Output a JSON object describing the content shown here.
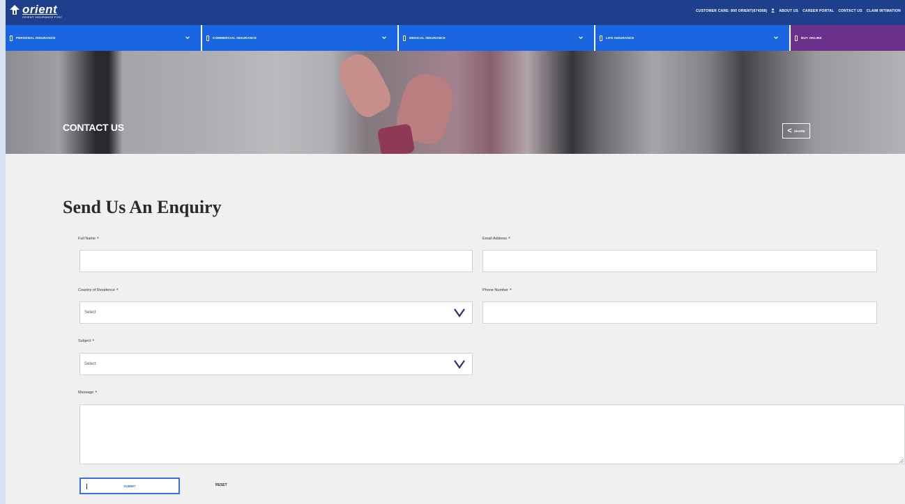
{
  "brand": {
    "logo_text": "orient",
    "logo_subtext": "ORIENT INSURANCE PJSC"
  },
  "toplinks": [
    "CUSTOMER CARE: 800 ORIENT(674368)",
    "ABOUT US",
    "CAREER PORTAL",
    "CONTACT US",
    "CLAIM INTIMATION"
  ],
  "nav": {
    "items": [
      {
        "label": "PERSONAL INSURANCE"
      },
      {
        "label": "COMMERCIAL INSURANCE"
      },
      {
        "label": "MEDICAL INSURANCE"
      },
      {
        "label": "LIFE INSURANCE"
      }
    ],
    "buy_label": "BUY ONLINE"
  },
  "hero": {
    "title": "CONTACT US",
    "share_label": "SHARE"
  },
  "form": {
    "title": "Send Us An Enquiry",
    "full_name_label": "Full Name",
    "email_label": "Email Address",
    "country_label": "Country of Residence",
    "country_value": "Select",
    "phone_label": "Phone Number",
    "subject_label": "Subject",
    "subject_value": "Select",
    "message_label": "Message",
    "required_mark": "*",
    "submit_label": "SUBMIT",
    "reset_label": "RESET"
  },
  "colors": {
    "topbar": "#1e3f8c",
    "nav_blue": "#1a66e0",
    "buy_purple": "#6b2f8c",
    "page_bg": "#f0f0f0",
    "border_strip": "#d8e4f6"
  }
}
